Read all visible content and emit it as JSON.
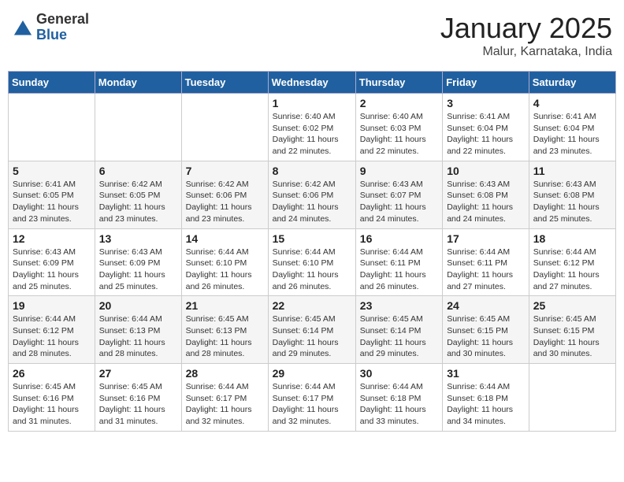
{
  "logo": {
    "general": "General",
    "blue": "Blue"
  },
  "title": "January 2025",
  "subtitle": "Malur, Karnataka, India",
  "days_of_week": [
    "Sunday",
    "Monday",
    "Tuesday",
    "Wednesday",
    "Thursday",
    "Friday",
    "Saturday"
  ],
  "weeks": [
    [
      {
        "day": "",
        "info": ""
      },
      {
        "day": "",
        "info": ""
      },
      {
        "day": "",
        "info": ""
      },
      {
        "day": "1",
        "info": "Sunrise: 6:40 AM\nSunset: 6:02 PM\nDaylight: 11 hours\nand 22 minutes."
      },
      {
        "day": "2",
        "info": "Sunrise: 6:40 AM\nSunset: 6:03 PM\nDaylight: 11 hours\nand 22 minutes."
      },
      {
        "day": "3",
        "info": "Sunrise: 6:41 AM\nSunset: 6:04 PM\nDaylight: 11 hours\nand 22 minutes."
      },
      {
        "day": "4",
        "info": "Sunrise: 6:41 AM\nSunset: 6:04 PM\nDaylight: 11 hours\nand 23 minutes."
      }
    ],
    [
      {
        "day": "5",
        "info": "Sunrise: 6:41 AM\nSunset: 6:05 PM\nDaylight: 11 hours\nand 23 minutes."
      },
      {
        "day": "6",
        "info": "Sunrise: 6:42 AM\nSunset: 6:05 PM\nDaylight: 11 hours\nand 23 minutes."
      },
      {
        "day": "7",
        "info": "Sunrise: 6:42 AM\nSunset: 6:06 PM\nDaylight: 11 hours\nand 23 minutes."
      },
      {
        "day": "8",
        "info": "Sunrise: 6:42 AM\nSunset: 6:06 PM\nDaylight: 11 hours\nand 24 minutes."
      },
      {
        "day": "9",
        "info": "Sunrise: 6:43 AM\nSunset: 6:07 PM\nDaylight: 11 hours\nand 24 minutes."
      },
      {
        "day": "10",
        "info": "Sunrise: 6:43 AM\nSunset: 6:08 PM\nDaylight: 11 hours\nand 24 minutes."
      },
      {
        "day": "11",
        "info": "Sunrise: 6:43 AM\nSunset: 6:08 PM\nDaylight: 11 hours\nand 25 minutes."
      }
    ],
    [
      {
        "day": "12",
        "info": "Sunrise: 6:43 AM\nSunset: 6:09 PM\nDaylight: 11 hours\nand 25 minutes."
      },
      {
        "day": "13",
        "info": "Sunrise: 6:43 AM\nSunset: 6:09 PM\nDaylight: 11 hours\nand 25 minutes."
      },
      {
        "day": "14",
        "info": "Sunrise: 6:44 AM\nSunset: 6:10 PM\nDaylight: 11 hours\nand 26 minutes."
      },
      {
        "day": "15",
        "info": "Sunrise: 6:44 AM\nSunset: 6:10 PM\nDaylight: 11 hours\nand 26 minutes."
      },
      {
        "day": "16",
        "info": "Sunrise: 6:44 AM\nSunset: 6:11 PM\nDaylight: 11 hours\nand 26 minutes."
      },
      {
        "day": "17",
        "info": "Sunrise: 6:44 AM\nSunset: 6:11 PM\nDaylight: 11 hours\nand 27 minutes."
      },
      {
        "day": "18",
        "info": "Sunrise: 6:44 AM\nSunset: 6:12 PM\nDaylight: 11 hours\nand 27 minutes."
      }
    ],
    [
      {
        "day": "19",
        "info": "Sunrise: 6:44 AM\nSunset: 6:12 PM\nDaylight: 11 hours\nand 28 minutes."
      },
      {
        "day": "20",
        "info": "Sunrise: 6:44 AM\nSunset: 6:13 PM\nDaylight: 11 hours\nand 28 minutes."
      },
      {
        "day": "21",
        "info": "Sunrise: 6:45 AM\nSunset: 6:13 PM\nDaylight: 11 hours\nand 28 minutes."
      },
      {
        "day": "22",
        "info": "Sunrise: 6:45 AM\nSunset: 6:14 PM\nDaylight: 11 hours\nand 29 minutes."
      },
      {
        "day": "23",
        "info": "Sunrise: 6:45 AM\nSunset: 6:14 PM\nDaylight: 11 hours\nand 29 minutes."
      },
      {
        "day": "24",
        "info": "Sunrise: 6:45 AM\nSunset: 6:15 PM\nDaylight: 11 hours\nand 30 minutes."
      },
      {
        "day": "25",
        "info": "Sunrise: 6:45 AM\nSunset: 6:15 PM\nDaylight: 11 hours\nand 30 minutes."
      }
    ],
    [
      {
        "day": "26",
        "info": "Sunrise: 6:45 AM\nSunset: 6:16 PM\nDaylight: 11 hours\nand 31 minutes."
      },
      {
        "day": "27",
        "info": "Sunrise: 6:45 AM\nSunset: 6:16 PM\nDaylight: 11 hours\nand 31 minutes."
      },
      {
        "day": "28",
        "info": "Sunrise: 6:44 AM\nSunset: 6:17 PM\nDaylight: 11 hours\nand 32 minutes."
      },
      {
        "day": "29",
        "info": "Sunrise: 6:44 AM\nSunset: 6:17 PM\nDaylight: 11 hours\nand 32 minutes."
      },
      {
        "day": "30",
        "info": "Sunrise: 6:44 AM\nSunset: 6:18 PM\nDaylight: 11 hours\nand 33 minutes."
      },
      {
        "day": "31",
        "info": "Sunrise: 6:44 AM\nSunset: 6:18 PM\nDaylight: 11 hours\nand 34 minutes."
      },
      {
        "day": "",
        "info": ""
      }
    ]
  ]
}
